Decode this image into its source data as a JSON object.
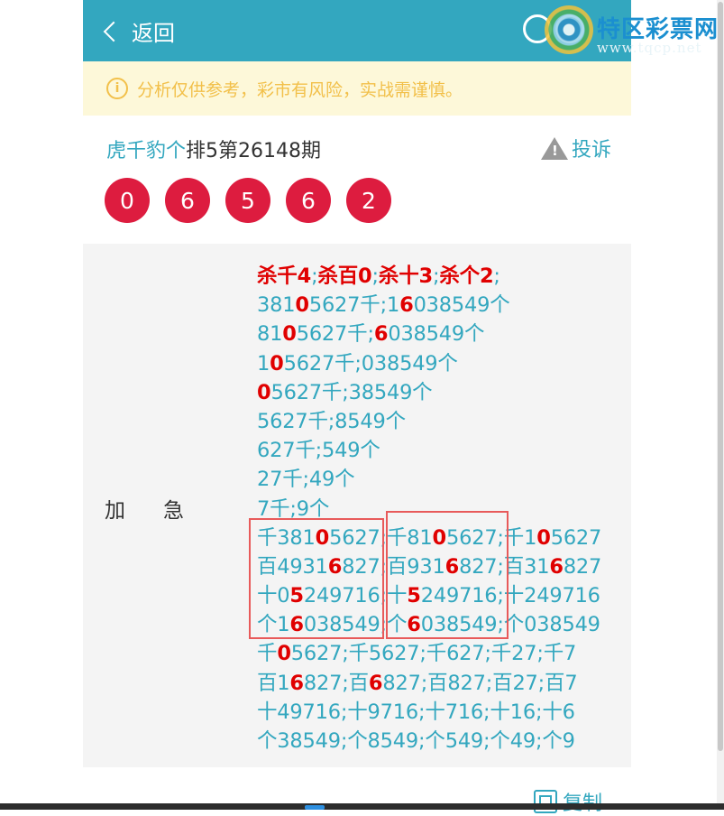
{
  "header": {
    "back_label": "返回",
    "watermark_title": "特区彩票网",
    "watermark_url": "www.tqcp.net"
  },
  "notice": {
    "icon": "info-icon",
    "text": "分析仅供参考，彩市有风险，实战需谨慎。"
  },
  "post": {
    "author": "虎千豹个",
    "issue": "排5第26148期",
    "complain_label": "投诉",
    "balls": [
      "0",
      "6",
      "5",
      "6",
      "2"
    ]
  },
  "content": {
    "label": "加急",
    "lines": [
      [
        [
          "r",
          "杀千4"
        ],
        [
          "n",
          ";"
        ],
        [
          "r",
          "杀百0"
        ],
        [
          "n",
          ";"
        ],
        [
          "r",
          "杀十3"
        ],
        [
          "n",
          ";"
        ],
        [
          "r",
          "杀个2"
        ],
        [
          "n",
          ";"
        ]
      ],
      [
        [
          "n",
          "381"
        ],
        [
          "r",
          "0"
        ],
        [
          "n",
          "5627千;1"
        ],
        [
          "r",
          "6"
        ],
        [
          "n",
          "038549个"
        ]
      ],
      [
        [
          "n",
          "81"
        ],
        [
          "r",
          "0"
        ],
        [
          "n",
          "5627千;"
        ],
        [
          "r",
          "6"
        ],
        [
          "n",
          "038549个"
        ]
      ],
      [
        [
          "n",
          "1"
        ],
        [
          "r",
          "0"
        ],
        [
          "n",
          "5627千;038549个"
        ]
      ],
      [
        [
          "r",
          "0"
        ],
        [
          "n",
          "5627千;38549个"
        ]
      ],
      [
        [
          "n",
          "5627千;8549个"
        ]
      ],
      [
        [
          "n",
          "627千;549个"
        ]
      ],
      [
        [
          "n",
          "27千;49个"
        ]
      ],
      [
        [
          "n",
          "7千;9个"
        ]
      ],
      [
        [
          "n",
          "千381"
        ],
        [
          "r",
          "0"
        ],
        [
          "n",
          "5627;千81"
        ],
        [
          "r",
          "0"
        ],
        [
          "n",
          "5627;千1"
        ],
        [
          "r",
          "0"
        ],
        [
          "n",
          "5627"
        ]
      ],
      [
        [
          "n",
          "百4931"
        ],
        [
          "r",
          "6"
        ],
        [
          "n",
          "827;百931"
        ],
        [
          "r",
          "6"
        ],
        [
          "n",
          "827;百31"
        ],
        [
          "r",
          "6"
        ],
        [
          "n",
          "827"
        ]
      ],
      [
        [
          "n",
          "十0"
        ],
        [
          "r",
          "5"
        ],
        [
          "n",
          "249716;十"
        ],
        [
          "r",
          "5"
        ],
        [
          "n",
          "249716;十249716"
        ]
      ],
      [
        [
          "n",
          "个1"
        ],
        [
          "r",
          "6"
        ],
        [
          "n",
          "038549;个"
        ],
        [
          "r",
          "6"
        ],
        [
          "n",
          "038549;个038549"
        ]
      ],
      [
        [
          "n",
          "千"
        ],
        [
          "r",
          "0"
        ],
        [
          "n",
          "5627;千5627;千627;千27;千7"
        ]
      ],
      [
        [
          "n",
          "百1"
        ],
        [
          "r",
          "6"
        ],
        [
          "n",
          "827;百"
        ],
        [
          "r",
          "6"
        ],
        [
          "n",
          "827;百827;百27;百7"
        ]
      ],
      [
        [
          "n",
          "十49716;十9716;十716;十16;十6"
        ]
      ],
      [
        [
          "n",
          "个38549;个8549;个549;个49;个9"
        ]
      ]
    ]
  },
  "actions": {
    "copy_label": "复制"
  },
  "colors": {
    "accent": "#33a7bf",
    "ball": "#dd1c3f",
    "notice_bg": "#fdf8d9",
    "notice_text": "#f2c04a",
    "highlight": "#e00000"
  }
}
